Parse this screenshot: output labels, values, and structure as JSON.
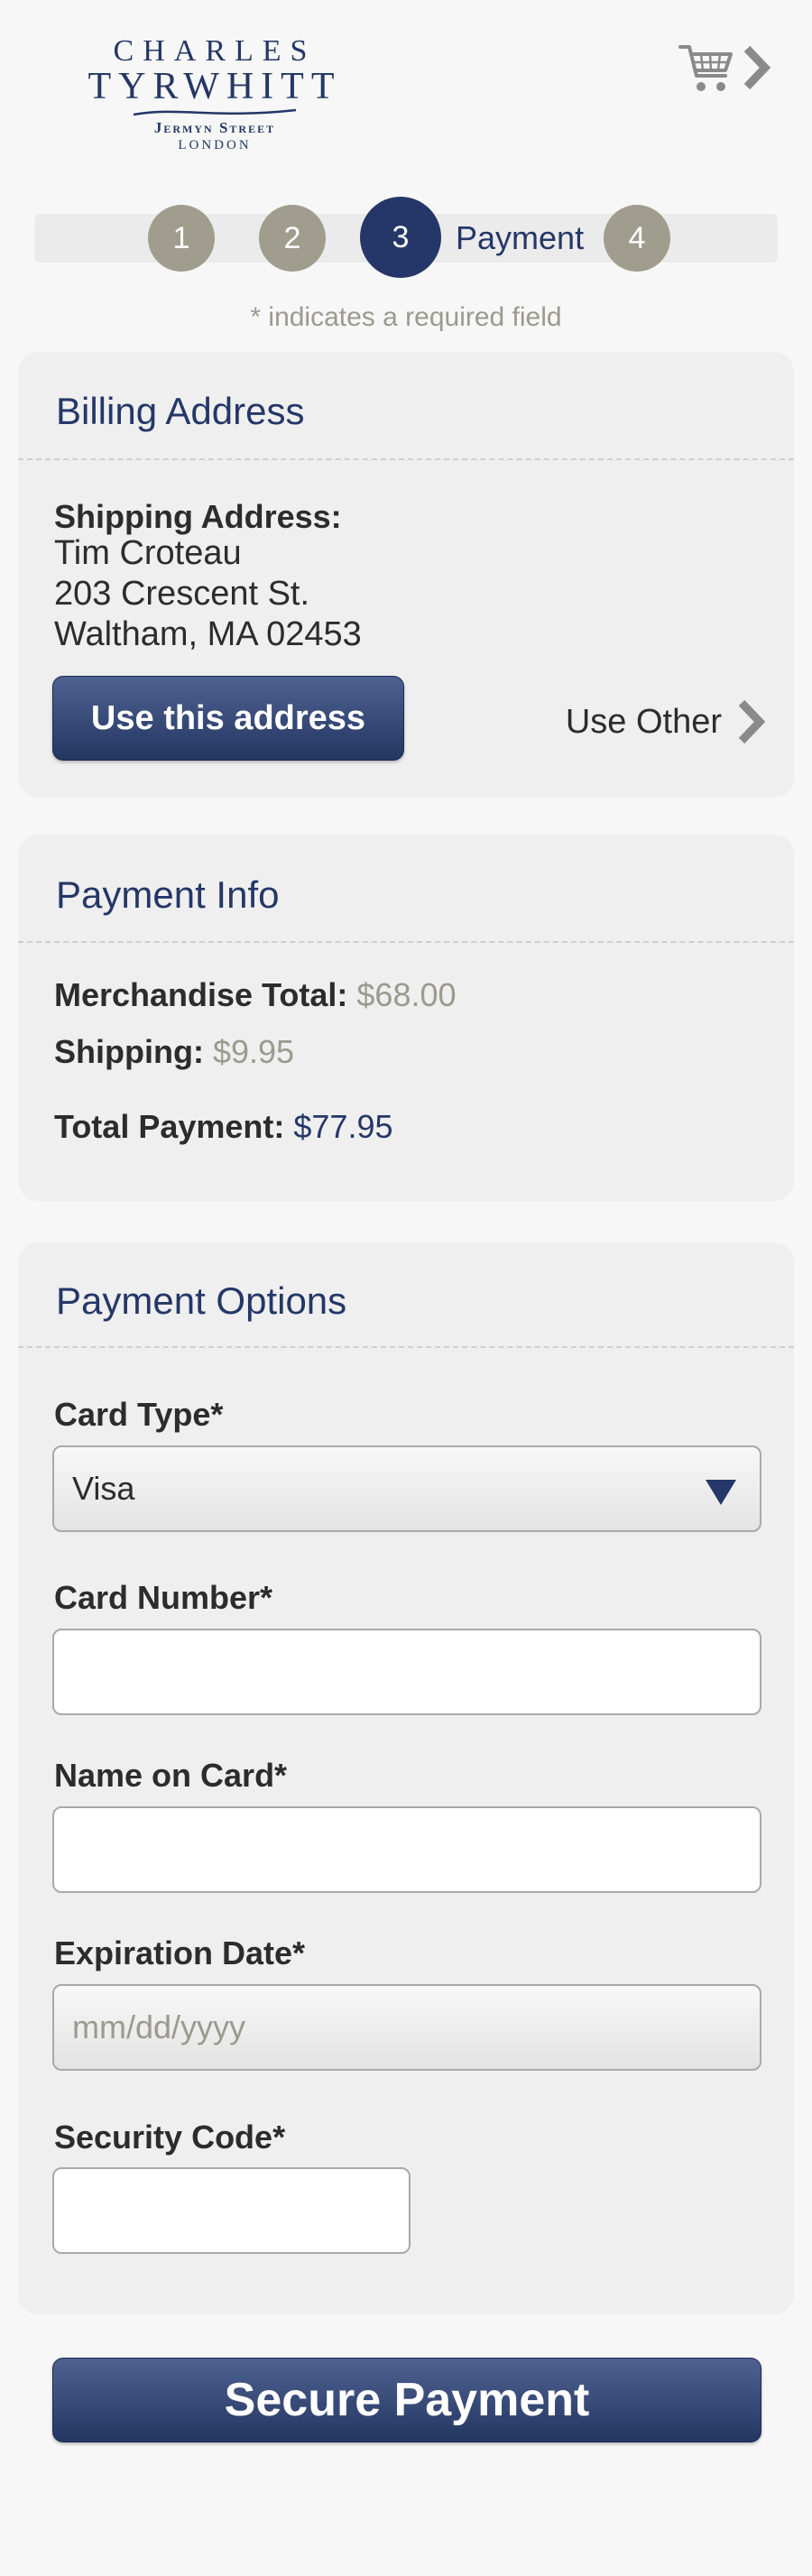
{
  "brand": {
    "line1": "CHARLES",
    "line2": "TYRWHITT",
    "line3": "Jermyn Street",
    "line4": "LONDON"
  },
  "header": {
    "cart_icon": "shopping-cart-icon",
    "next_icon": "chevron-right-icon"
  },
  "steps": [
    {
      "number": "1",
      "state": "done"
    },
    {
      "number": "2",
      "state": "done"
    },
    {
      "number": "3",
      "state": "active",
      "label": "Payment"
    },
    {
      "number": "4",
      "state": "upcoming"
    }
  ],
  "required_note": "* indicates a required field",
  "billing": {
    "title": "Billing Address",
    "heading": "Shipping Address:",
    "name": "Tim Croteau",
    "street": "203 Crescent St.",
    "city": "Waltham, MA 02453",
    "use_button": "Use this address",
    "use_other": "Use Other"
  },
  "payment_info": {
    "title": "Payment Info",
    "merch_label": "Merchandise Total:",
    "merch_value": "$68.00",
    "shipping_label": "Shipping:",
    "shipping_value": "$9.95",
    "total_label": "Total Payment:",
    "total_value": "$77.95"
  },
  "payment_options": {
    "title": "Payment Options",
    "card_type_label": "Card Type*",
    "card_type_value": "Visa",
    "card_number_label": "Card Number*",
    "card_number_value": "",
    "name_label": "Name on Card*",
    "name_value": "",
    "expiration_label": "Expiration Date*",
    "expiration_placeholder": "mm/dd/yyyy",
    "security_label": "Security Code*",
    "security_value": ""
  },
  "submit_label": "Secure Payment",
  "colors": {
    "navy": "#253768",
    "step_gray": "#a09d8f",
    "muted": "#9a9a8e"
  }
}
